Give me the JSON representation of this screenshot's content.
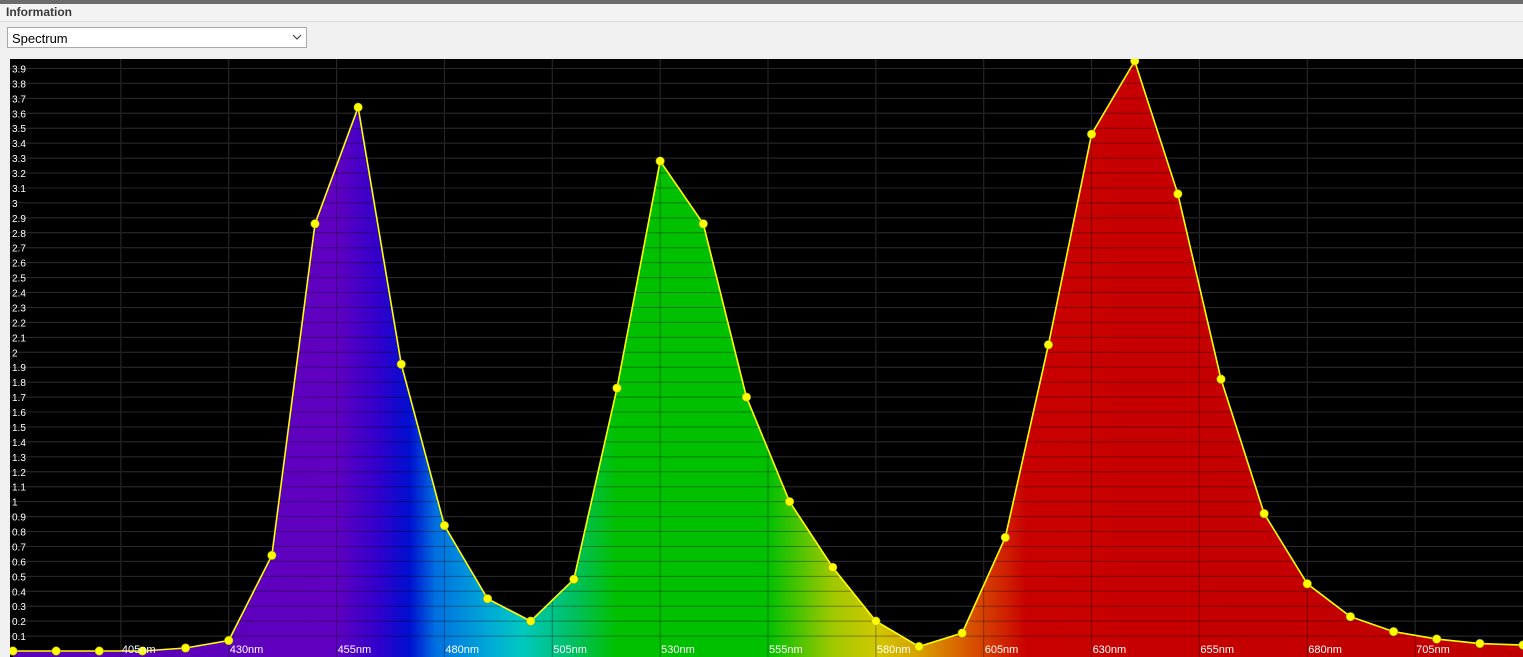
{
  "panel": {
    "title": "Information"
  },
  "view_select": {
    "selected": "Spectrum",
    "icon": "chevron-down-icon"
  },
  "colors": {
    "background": "#000000",
    "grid": "#404040",
    "line": "#ffff00",
    "marker": "#ffff00",
    "tick_text": "#ffffff",
    "fill_stops": [
      {
        "nm": 405,
        "color": "#5a00b8"
      },
      {
        "nm": 455,
        "color": "#6000c0"
      },
      {
        "nm": 465,
        "color": "#3000cc"
      },
      {
        "nm": 472,
        "color": "#0010d0"
      },
      {
        "nm": 478,
        "color": "#0070e0"
      },
      {
        "nm": 490,
        "color": "#00a8d8"
      },
      {
        "nm": 498,
        "color": "#00c8c0"
      },
      {
        "nm": 510,
        "color": "#00c060"
      },
      {
        "nm": 520,
        "color": "#00c000"
      },
      {
        "nm": 555,
        "color": "#00c000"
      },
      {
        "nm": 570,
        "color": "#a0c800"
      },
      {
        "nm": 580,
        "color": "#d0c800"
      },
      {
        "nm": 590,
        "color": "#d8a000"
      },
      {
        "nm": 600,
        "color": "#d86000"
      },
      {
        "nm": 610,
        "color": "#d02000"
      },
      {
        "nm": 615,
        "color": "#c80000"
      },
      {
        "nm": 730,
        "color": "#c00000"
      }
    ]
  },
  "chart_data": {
    "type": "area",
    "xlabel": "",
    "ylabel": "",
    "xlim": [
      380,
      730
    ],
    "ylim": [
      0,
      3.95
    ],
    "grid": true,
    "legend": "none",
    "x_ticks": [
      405,
      430,
      455,
      480,
      505,
      530,
      555,
      580,
      605,
      630,
      655,
      680,
      705
    ],
    "x_tick_labels": [
      "405nm",
      "430nm",
      "455nm",
      "480nm",
      "505nm",
      "530nm",
      "555nm",
      "580nm",
      "605nm",
      "630nm",
      "655nm",
      "680nm",
      "705nm"
    ],
    "y_ticks": [
      0.1,
      0.2,
      0.3,
      0.4,
      0.5,
      0.6,
      0.7,
      0.8,
      0.9,
      1,
      1.1,
      1.2,
      1.3,
      1.4,
      1.5,
      1.6,
      1.7,
      1.8,
      1.9,
      2,
      2.1,
      2.2,
      2.3,
      2.4,
      2.5,
      2.6,
      2.7,
      2.8,
      2.9,
      3,
      3.1,
      3.2,
      3.3,
      3.4,
      3.5,
      3.6,
      3.7,
      3.8,
      3.9
    ],
    "y_tick_labels": [
      "0.1",
      "0.2",
      "0.3",
      "0.4",
      "0.5",
      "0.6",
      "0.7",
      "0.8",
      "0.9",
      "1",
      "1.1",
      "1.2",
      "1.3",
      "1.4",
      "1.5",
      "1.6",
      "1.7",
      "1.8",
      "1.9",
      "2",
      "2.1",
      "2.2",
      "2.3",
      "2.4",
      "2.5",
      "2.6",
      "2.7",
      "2.8",
      "2.9",
      "3",
      "3.1",
      "3.2",
      "3.3",
      "3.4",
      "3.5",
      "3.6",
      "3.7",
      "3.8",
      "3.9"
    ],
    "series": [
      {
        "x": [
          380,
          390,
          400,
          410,
          420,
          430,
          440,
          450,
          460,
          470,
          480,
          490,
          500,
          510,
          520,
          530,
          540,
          550,
          560,
          570,
          580,
          590,
          600,
          610,
          620,
          630,
          640,
          650,
          660,
          670,
          680,
          690,
          700,
          710,
          720,
          730
        ],
        "y": [
          0.0,
          0.0,
          0.0,
          0.0,
          0.02,
          0.07,
          0.64,
          2.86,
          3.64,
          1.92,
          0.84,
          0.35,
          0.2,
          0.48,
          1.76,
          3.28,
          2.86,
          1.7,
          1.0,
          0.56,
          0.2,
          0.03,
          0.12,
          0.76,
          2.05,
          3.46,
          3.95,
          3.06,
          1.82,
          0.92,
          0.45,
          0.23,
          0.13,
          0.08,
          0.05,
          0.04
        ]
      }
    ]
  }
}
